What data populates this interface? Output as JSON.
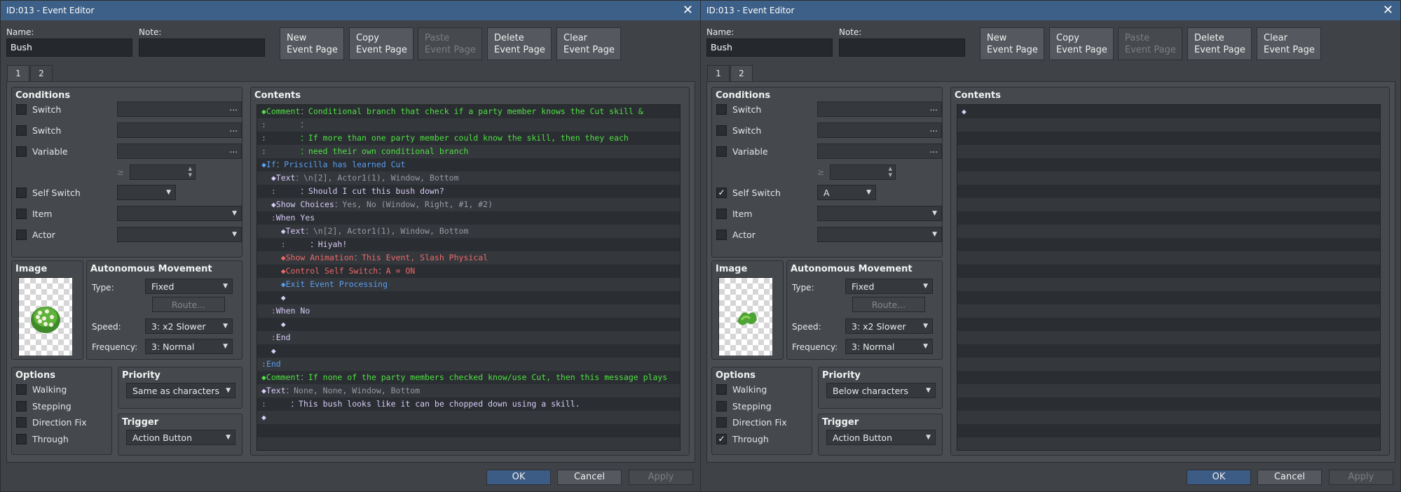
{
  "windows": [
    {
      "title": "ID:013 - Event Editor",
      "close": "✕",
      "name_label": "Name:",
      "name_value": "Bush",
      "note_label": "Note:",
      "note_value": "",
      "page_buttons": [
        "New\nEvent Page",
        "Copy\nEvent Page",
        "Paste\nEvent Page",
        "Delete\nEvent Page",
        "Clear\nEvent Page"
      ],
      "tabs": [
        "1",
        "2"
      ],
      "active_tab": 0,
      "conditions": {
        "title": "Conditions",
        "switch1": "Switch",
        "switch2": "Switch",
        "variable": "Variable",
        "ge": "≥",
        "self_switch": "Self Switch",
        "self_switch_value": "",
        "self_switch_checked": false,
        "item": "Item",
        "actor": "Actor",
        "through_checked": false,
        "ellipsis": "..."
      },
      "image_title": "Image",
      "image_icon": "bush-flowers",
      "auto": {
        "title": "Autonomous Movement",
        "type_label": "Type:",
        "type_value": "Fixed",
        "route": "Route...",
        "speed_label": "Speed:",
        "speed_value": "3: x2 Slower",
        "freq_label": "Frequency:",
        "freq_value": "3: Normal"
      },
      "options": {
        "title": "Options",
        "walking": "Walking",
        "stepping": "Stepping",
        "direction_fix": "Direction Fix",
        "through": "Through"
      },
      "priority": {
        "title": "Priority",
        "value": "Same as characters"
      },
      "trigger": {
        "title": "Trigger",
        "value": "Action Button"
      },
      "contents_title": "Contents",
      "lines": [
        [
          [
            "◆Comment",
            "cg"
          ],
          [
            "：",
            "cc"
          ],
          [
            "Conditional branch that check if a party member knows the Cut skill &",
            "cg"
          ]
        ],
        [
          [
            ":",
            "cc"
          ],
          [
            "       ：",
            "cc"
          ]
        ],
        [
          [
            ":",
            "cc"
          ],
          [
            "       ：If more than one party member could know the skill, then they each",
            "cg"
          ]
        ],
        [
          [
            ":",
            "cc"
          ],
          [
            "       ：need their own conditional branch",
            "cg"
          ]
        ],
        [
          [
            "◆If",
            "cb2"
          ],
          [
            "：",
            "cc"
          ],
          [
            "Priscilla has learned Cut",
            "cb2"
          ]
        ],
        [
          [
            "  ◆Text",
            "cw"
          ],
          [
            "：",
            "cc"
          ],
          [
            "\\n[2], Actor1(1), Window, Bottom",
            "cc"
          ]
        ],
        [
          [
            "  :",
            "cc"
          ],
          [
            "     ：Should I cut this bush down?",
            "cw"
          ]
        ],
        [
          [
            "  ◆Show Choices",
            "cw"
          ],
          [
            "：",
            "cc"
          ],
          [
            "Yes, No (Window, Right, #1, #2)",
            "cc"
          ]
        ],
        [
          [
            "  :",
            "cc"
          ],
          [
            "When Yes",
            "cw"
          ]
        ],
        [
          [
            "    ◆Text",
            "cw"
          ],
          [
            "：",
            "cc"
          ],
          [
            "\\n[2], Actor1(1), Window, Bottom",
            "cc"
          ]
        ],
        [
          [
            "    :",
            "cc"
          ],
          [
            "     ：Hiyah!",
            "cw"
          ]
        ],
        [
          [
            "    ◆Show Animation",
            "cr"
          ],
          [
            "：",
            "cc"
          ],
          [
            "This Event, Slash Physical",
            "cr"
          ]
        ],
        [
          [
            "    ◆Control Self Switch",
            "cr"
          ],
          [
            "：",
            "cc"
          ],
          [
            "A = ON",
            "cr"
          ]
        ],
        [
          [
            "    ◆Exit Event Processing",
            "cb2"
          ]
        ],
        [
          [
            "    ◆",
            "cw"
          ]
        ],
        [
          [
            "  :",
            "cc"
          ],
          [
            "When No",
            "cw"
          ]
        ],
        [
          [
            "    ◆",
            "cw"
          ]
        ],
        [
          [
            "  :",
            "cc"
          ],
          [
            "End",
            "cw"
          ]
        ],
        [
          [
            "  ◆",
            "cw"
          ]
        ],
        [
          [
            ":",
            "cc"
          ],
          [
            "End",
            "cb2"
          ]
        ],
        [
          [
            "◆Comment",
            "cg"
          ],
          [
            "：",
            "cc"
          ],
          [
            "If none of the party members checked know/use Cut, then this message plays",
            "cg"
          ]
        ],
        [
          [
            "◆Text",
            "cw"
          ],
          [
            "：",
            "cc"
          ],
          [
            "None, None, Window, Bottom",
            "cc"
          ]
        ],
        [
          [
            ":",
            "cc"
          ],
          [
            "     ：This bush looks like it can be chopped down using a skill.",
            "cw"
          ]
        ],
        [
          [
            "◆",
            "cw"
          ]
        ]
      ],
      "ok": "OK",
      "cancel": "Cancel",
      "apply": "Apply"
    },
    {
      "title": "ID:013 - Event Editor",
      "close": "✕",
      "name_label": "Name:",
      "name_value": "Bush",
      "note_label": "Note:",
      "note_value": "",
      "page_buttons": [
        "New\nEvent Page",
        "Copy\nEvent Page",
        "Paste\nEvent Page",
        "Delete\nEvent Page",
        "Clear\nEvent Page"
      ],
      "tabs": [
        "1",
        "2"
      ],
      "active_tab": 1,
      "conditions": {
        "title": "Conditions",
        "switch1": "Switch",
        "switch2": "Switch",
        "variable": "Variable",
        "ge": "≥",
        "self_switch": "Self Switch",
        "self_switch_value": "A",
        "self_switch_checked": true,
        "item": "Item",
        "actor": "Actor",
        "through_checked": true,
        "ellipsis": "..."
      },
      "image_title": "Image",
      "image_icon": "cut-bush",
      "auto": {
        "title": "Autonomous Movement",
        "type_label": "Type:",
        "type_value": "Fixed",
        "route": "Route...",
        "speed_label": "Speed:",
        "speed_value": "3: x2 Slower",
        "freq_label": "Frequency:",
        "freq_value": "3: Normal"
      },
      "options": {
        "title": "Options",
        "walking": "Walking",
        "stepping": "Stepping",
        "direction_fix": "Direction Fix",
        "through": "Through"
      },
      "priority": {
        "title": "Priority",
        "value": "Below characters"
      },
      "trigger": {
        "title": "Trigger",
        "value": "Action Button"
      },
      "contents_title": "Contents",
      "lines": [
        [
          [
            "◆",
            "cw"
          ]
        ]
      ],
      "ok": "OK",
      "cancel": "Cancel",
      "apply": "Apply"
    }
  ]
}
